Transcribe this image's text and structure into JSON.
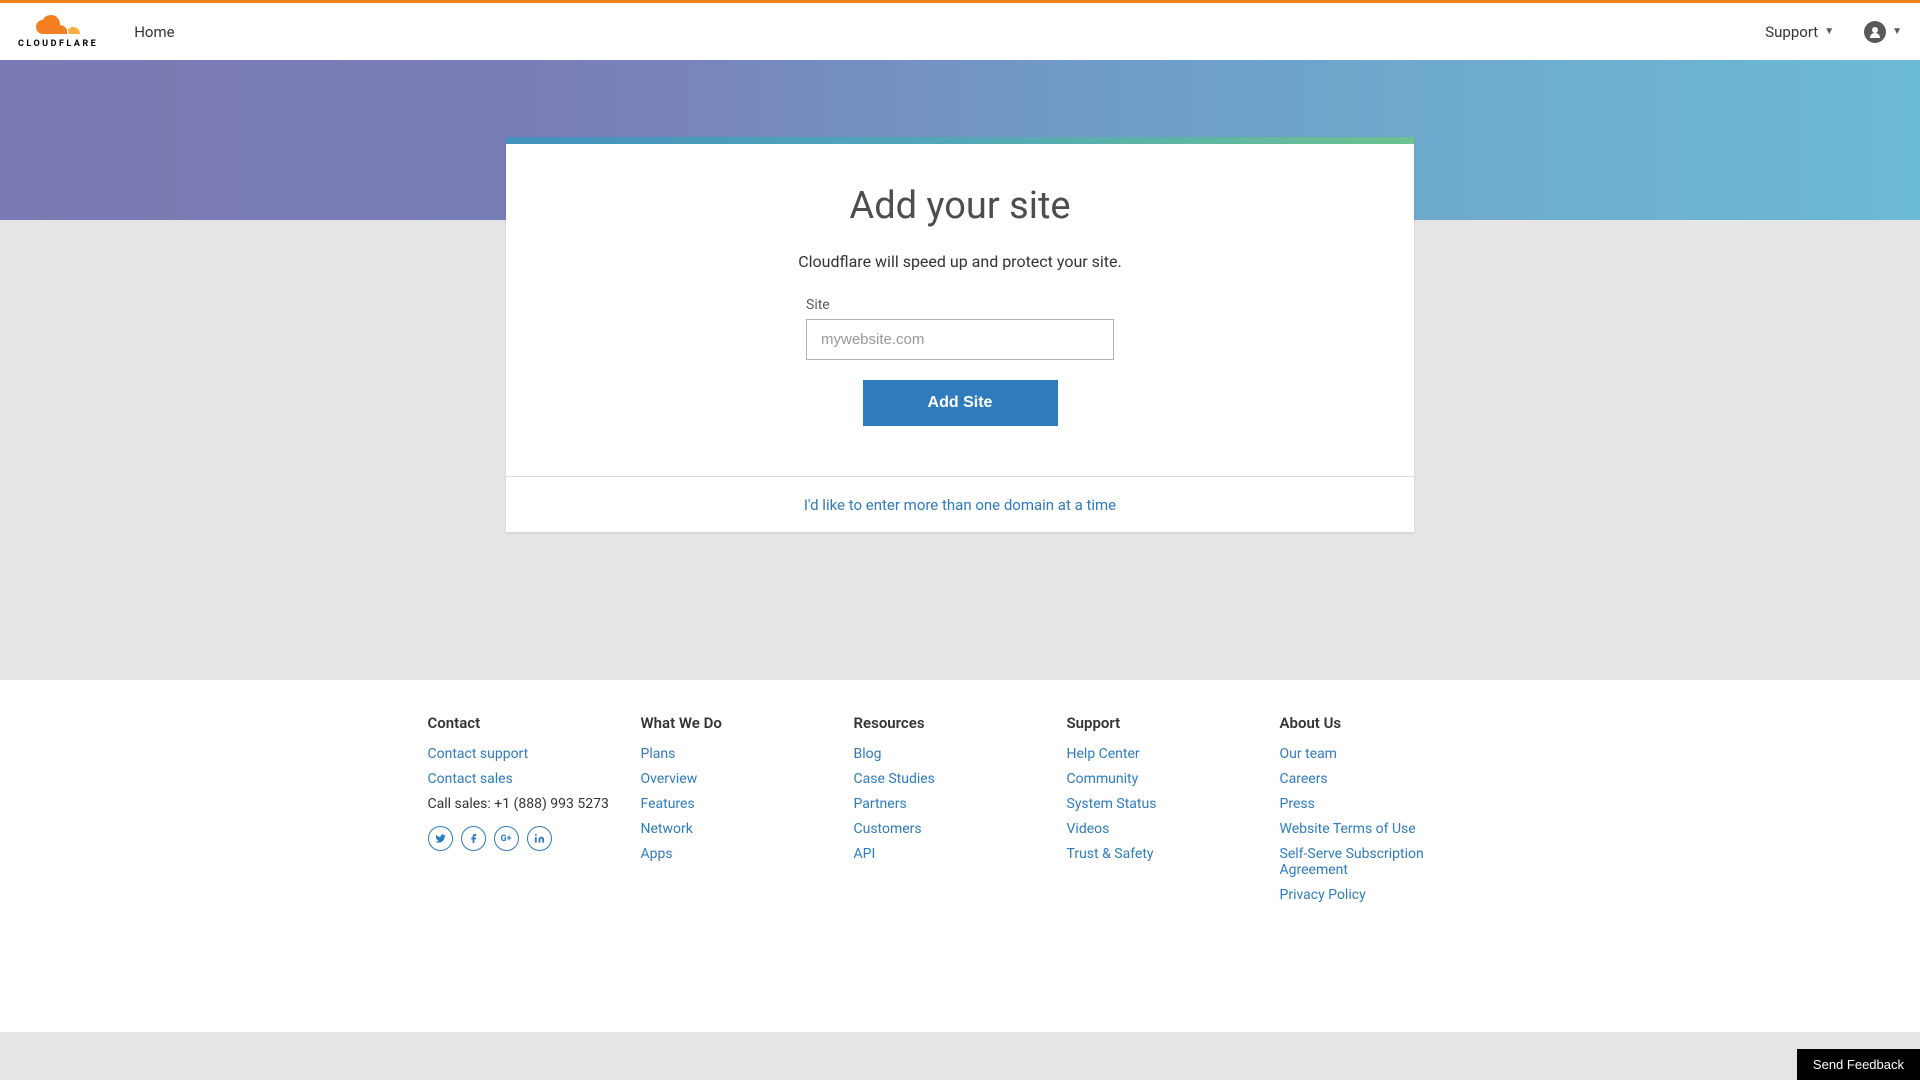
{
  "header": {
    "logo_text": "CLOUDFLARE",
    "nav_home": "Home",
    "support_label": "Support"
  },
  "card": {
    "title": "Add your site",
    "subtitle": "Cloudflare will speed up and protect your site.",
    "input_label": "Site",
    "input_placeholder": "mywebsite.com",
    "button_label": "Add Site",
    "footer_link": "I'd like to enter more than one domain at a time"
  },
  "footer": {
    "contact": {
      "heading": "Contact",
      "links": [
        "Contact support",
        "Contact sales"
      ],
      "call_text": "Call sales: +1 (888) 993 5273"
    },
    "what_we_do": {
      "heading": "What We Do",
      "links": [
        "Plans",
        "Overview",
        "Features",
        "Network",
        "Apps"
      ]
    },
    "resources": {
      "heading": "Resources",
      "links": [
        "Blog",
        "Case Studies",
        "Partners",
        "Customers",
        "API"
      ]
    },
    "support": {
      "heading": "Support",
      "links": [
        "Help Center",
        "Community",
        "System Status",
        "Videos",
        "Trust & Safety"
      ]
    },
    "about": {
      "heading": "About Us",
      "links": [
        "Our team",
        "Careers",
        "Press",
        "Website Terms of Use",
        "Self-Serve Subscription Agreement",
        "Privacy Policy"
      ]
    }
  },
  "feedback_label": "Send Feedback"
}
